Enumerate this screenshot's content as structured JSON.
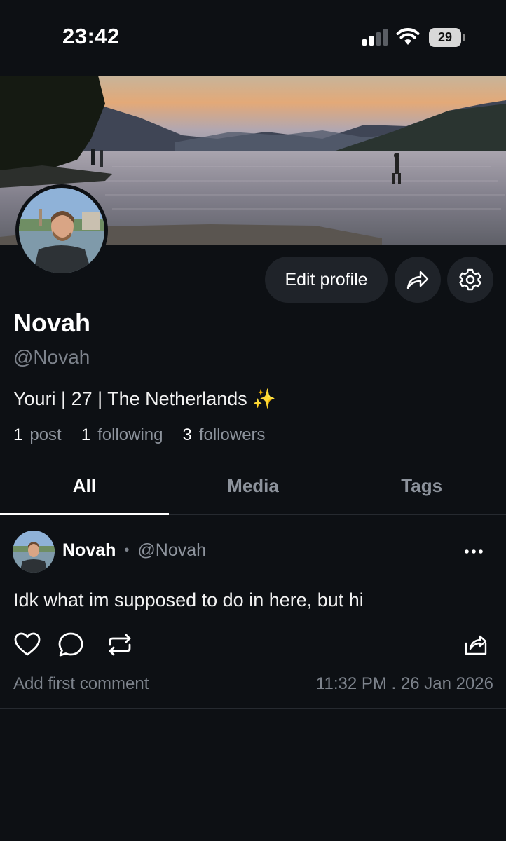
{
  "status_bar": {
    "time": "23:42",
    "battery": "29",
    "icons": [
      "signal-icon",
      "wifi-icon",
      "battery-icon"
    ]
  },
  "profile": {
    "display_name": "Novah",
    "handle": "@Novah",
    "bio": "Youri | 27 | The Netherlands ✨",
    "stats": [
      {
        "count": "1",
        "label": "post"
      },
      {
        "count": "1",
        "label": "following"
      },
      {
        "count": "3",
        "label": "followers"
      }
    ]
  },
  "actions": {
    "edit_profile": "Edit profile",
    "icons": [
      "share-icon",
      "gear-icon"
    ]
  },
  "tabs": [
    {
      "label": "All",
      "active": true
    },
    {
      "label": "Media",
      "active": false
    },
    {
      "label": "Tags",
      "active": false
    }
  ],
  "post": {
    "author_name": "Novah",
    "separator": "•",
    "author_handle": "@Novah",
    "text": "Idk what im supposed to do in here, but hi",
    "add_comment": "Add first comment",
    "timestamp": "11:32 PM . 26 Jan 2026",
    "action_icons": [
      "heart-icon",
      "comment-icon",
      "repost-icon",
      "share-icon",
      "more-icon"
    ]
  },
  "colors": {
    "background": "#0d1014",
    "button_bg": "#1f2329",
    "muted_text": "#8d939c",
    "divider": "#262a30"
  }
}
